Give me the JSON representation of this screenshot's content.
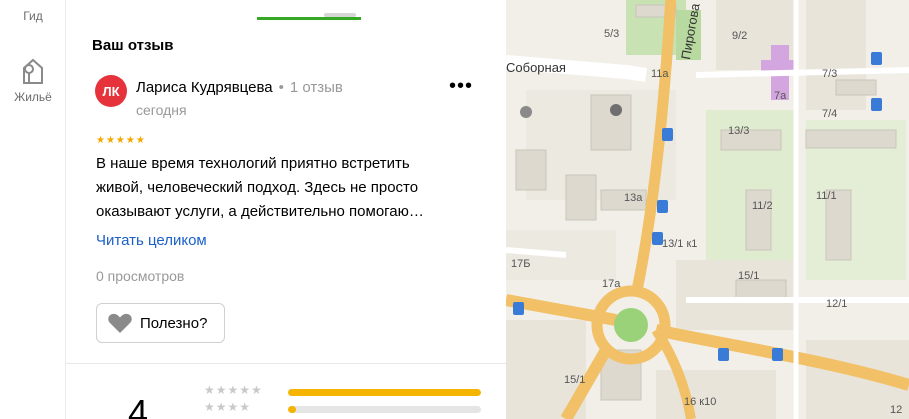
{
  "rail": {
    "items": [
      {
        "label": "Гид",
        "icon": "guide-icon"
      },
      {
        "label": "Жильё",
        "icon": "home-icon"
      }
    ]
  },
  "review_section": {
    "title": "Ваш отзыв",
    "author": {
      "initials": "ЛК",
      "name": "Лариса Кудрявцева",
      "reviews_count": "1 отзыв",
      "date": "сегодня",
      "avatar_color": "#e5323b"
    },
    "rating_stars": "★★★★★",
    "text_lines": [
      "В наше время технологий приятно встретить",
      "живой, человеческий подход. Здесь не просто",
      "оказывают услуги, а действительно помогаю…"
    ],
    "read_more": "Читать целиком",
    "views": "0 просмотров",
    "useful_label": "Полезно?",
    "more_label": "•••"
  },
  "rating_summary": {
    "average": "4",
    "rows": [
      {
        "stars": 5,
        "stars_glyphs": "★★★★★",
        "fill_fraction": 1.0
      },
      {
        "stars": 4,
        "stars_glyphs": "★★★★",
        "fill_fraction": 0.04
      }
    ],
    "bar_color": "#f5b400"
  },
  "map": {
    "streets": [
      "Соборная",
      "Пирогова"
    ],
    "labels": [
      "5/3",
      "9/2",
      "11а",
      "7/3",
      "7а",
      "7/4",
      "13/3",
      "13а",
      "11/2",
      "11/1",
      "13/1 к1",
      "17Б",
      "17а",
      "15/1",
      "12/1",
      "15/1",
      "16 к10",
      "12"
    ]
  }
}
